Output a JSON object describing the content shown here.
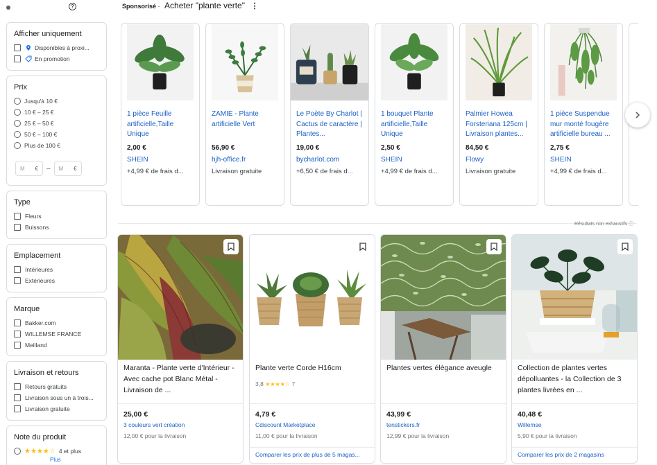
{
  "filters": {
    "afficher": {
      "heading": "Afficher uniquement",
      "options": [
        "Disponibles à proxi...",
        "En promotion"
      ]
    },
    "prix": {
      "heading": "Prix",
      "options": [
        "Jusqu'à 10 €",
        "10 € – 25 €",
        "25 € – 50 €",
        "50 € – 100 €",
        "Plus de 100 €"
      ],
      "min_placeholder": "M",
      "max_placeholder": "M",
      "currency": "€",
      "separator": "–"
    },
    "type": {
      "heading": "Type",
      "options": [
        "Fleurs",
        "Buissons"
      ]
    },
    "emplacement": {
      "heading": "Emplacement",
      "options": [
        "Intérieures",
        "Extérieures"
      ]
    },
    "marque": {
      "heading": "Marque",
      "options": [
        "Bakker.com",
        "WILLEMSE FRANCE",
        "Meilland"
      ]
    },
    "livraison": {
      "heading": "Livraison et retours",
      "options": [
        "Retours gratuits",
        "Livraison sous un à trois...",
        "Livraison gratuite"
      ]
    },
    "note": {
      "heading": "Note du produit",
      "stars": "★★★★☆",
      "label": "4 et plus",
      "more": "Plus"
    }
  },
  "sponsored": {
    "label": "Sponsorisé",
    "dot": "·",
    "title": "Acheter \"plante verte\"",
    "menu": "⋮",
    "next_icon": "chevron-right-icon",
    "products": [
      {
        "name": "1 pièce Feuille artificielle,Taille Unique",
        "price": "2,00 €",
        "shop": "SHEIN",
        "ship": "+4,99 € de frais d..."
      },
      {
        "name": "ZAMIE - Plante artificielle Vert",
        "price": "56,90 €",
        "shop": "hjh-office.fr",
        "ship": "Livraison gratuite"
      },
      {
        "name": "Le Poète By Charlot | Cactus de caractère | Plantes...",
        "price": "19,00 €",
        "shop": "bycharlot.com",
        "ship": "+6,50 € de frais d..."
      },
      {
        "name": "1 bouquet Plante artificielle,Taille Unique",
        "price": "2,50 €",
        "shop": "SHEIN",
        "ship": "+4,99 € de frais d..."
      },
      {
        "name": "Palmier Howea Forsteriana 125cm | Livraison plantes...",
        "price": "84,50 €",
        "shop": "Flowy",
        "ship": "Livraison gratuite"
      },
      {
        "name": "1 pièce Suspendue mur monté fougère artificielle bureau ...",
        "price": "2,75 €",
        "shop": "SHEIN",
        "ship": "+4,99 € de frais d..."
      }
    ]
  },
  "nonexhaustive": "Résultats non exhaustifs",
  "results": [
    {
      "title": "Maranta - Plante verte d'Intérieur - Avec cache pot Blanc Métal - Livraison de ...",
      "rating": "",
      "stars": "",
      "count": "",
      "price": "25,00 €",
      "shop": "3 couleurs vert création",
      "ship": "12,00 € pour la livraison",
      "compare": ""
    },
    {
      "title": "Plante verte Corde H16cm",
      "rating": "3,8",
      "stars": "★★★★☆",
      "count": "7",
      "price": "4,79 €",
      "shop": "Cdiscount Marketplace",
      "ship": "11,00 € pour la livraison",
      "compare": "Comparer les prix de plus de 5 magas..."
    },
    {
      "title": "Plantes vertes élégance aveugle",
      "rating": "",
      "stars": "",
      "count": "",
      "price": "43,99 €",
      "shop": "tenstickers.fr",
      "ship": "12,99 € pour la livraison",
      "compare": ""
    },
    {
      "title": "Collection de plantes vertes dépolluantes - la Collection de 3 plantes livrées en ...",
      "rating": "",
      "stars": "",
      "count": "",
      "price": "40,48 €",
      "shop": "Willemse",
      "ship": "5,90 € pour la livraison",
      "compare": "Comparer les prix de 2 magasins"
    }
  ]
}
